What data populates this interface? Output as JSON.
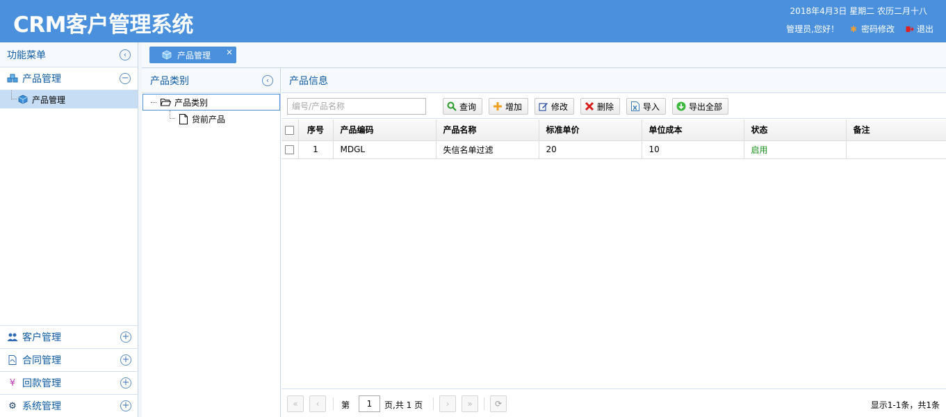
{
  "header": {
    "title": "CRM客户管理系统",
    "date": "2018年4月3日 星期二 农历二月十八",
    "greeting": "管理员,您好！",
    "change_password": "密码修改",
    "logout": "退出"
  },
  "left_menu": {
    "title": "功能菜单",
    "active_section": {
      "label": "产品管理",
      "items": [
        {
          "label": "产品管理"
        }
      ]
    },
    "sections": [
      {
        "label": "客户管理",
        "icon": "users-icon"
      },
      {
        "label": "合同管理",
        "icon": "document-icon"
      },
      {
        "label": "回款管理",
        "icon": "yen-icon"
      },
      {
        "label": "系统管理",
        "icon": "gear-icon"
      }
    ]
  },
  "tabs": [
    {
      "label": "产品管理",
      "close": "×"
    }
  ],
  "category_panel": {
    "title": "产品类别",
    "tree": {
      "root": "产品类别",
      "children": [
        "贷前产品"
      ]
    }
  },
  "info_panel": {
    "title": "产品信息",
    "search": {
      "placeholder": "编号/产品名称",
      "value": ""
    },
    "buttons": {
      "query": "查询",
      "add": "增加",
      "edit": "修改",
      "delete": "删除",
      "import": "导入",
      "export_all": "导出全部"
    },
    "columns": [
      "序号",
      "产品编码",
      "产品名称",
      "标准单价",
      "单位成本",
      "状态",
      "备注"
    ],
    "rows": [
      {
        "index": "1",
        "code": "MDGL",
        "name": "失信名单过滤",
        "price": "20",
        "cost": "10",
        "status": "启用",
        "remark": ""
      }
    ],
    "pager": {
      "page_prefix": "第",
      "page_value": "1",
      "page_suffix": "页,共 1 页",
      "info": "显示1-1条，共1条"
    }
  },
  "colors": {
    "header_bg": "#4a90dc",
    "accent_text": "#0e5ba3",
    "active_menu_bg": "#c7ddf3",
    "status_enabled": "#1a8f1a"
  }
}
